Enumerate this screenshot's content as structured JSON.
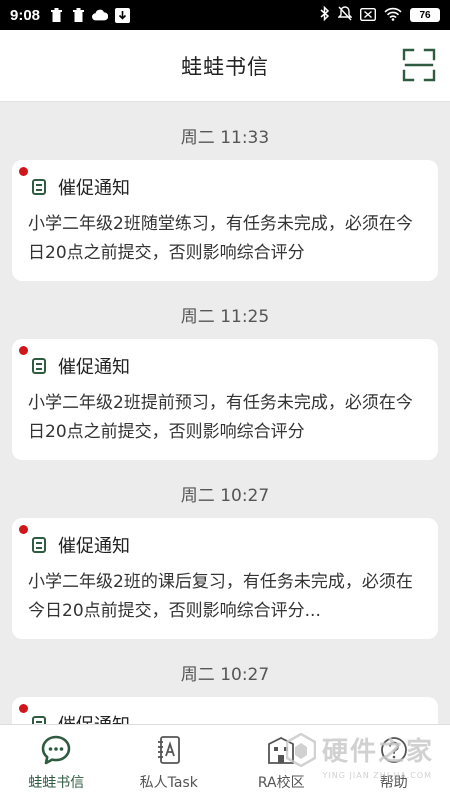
{
  "status_bar": {
    "time": "9:08",
    "battery": "76",
    "left_icons": [
      "trash-icon",
      "trash-icon",
      "cloud-icon",
      "download-icon"
    ],
    "right_icons": [
      "bluetooth-icon",
      "vibrate-icon",
      "no-sim-icon",
      "wifi-icon"
    ]
  },
  "header": {
    "title": "蛙蛙书信",
    "scan_icon": "scan-icon"
  },
  "feed": [
    {
      "time": "周二 11:33",
      "title": "催促通知",
      "body": "小学二年级2班随堂练习，有任务未完成，必须在今日20点之前提交，否则影响综合评分",
      "unread": true
    },
    {
      "time": "周二 11:25",
      "title": "催促通知",
      "body": "小学二年级2班提前预习，有任务未完成，必须在今日20点之前提交，否则影响综合评分",
      "unread": true
    },
    {
      "time": "周二 10:27",
      "title": "催促通知",
      "body": "小学二年级2班的课后复习，有任务未完成，必须在今日20点前提交，否则影响综合评分...",
      "unread": true
    },
    {
      "time": "周二 10:27",
      "title": "催促通知",
      "body": "",
      "unread": true
    }
  ],
  "tabbar": {
    "tabs": [
      {
        "label": "蛙蛙书信",
        "icon": "chat-bubble-icon",
        "active": true
      },
      {
        "label": "私人Task",
        "icon": "notebook-icon",
        "active": false
      },
      {
        "label": "RA校区",
        "icon": "building-icon",
        "active": false
      },
      {
        "label": "帮助",
        "icon": "help-icon",
        "active": false
      }
    ]
  },
  "watermark": {
    "text": "硬件之家",
    "sub": "YING JIAN ZHI JIA.COM"
  },
  "colors": {
    "accent": "#2f5b41",
    "unread_dot": "#d0161b",
    "background": "#ececec"
  }
}
